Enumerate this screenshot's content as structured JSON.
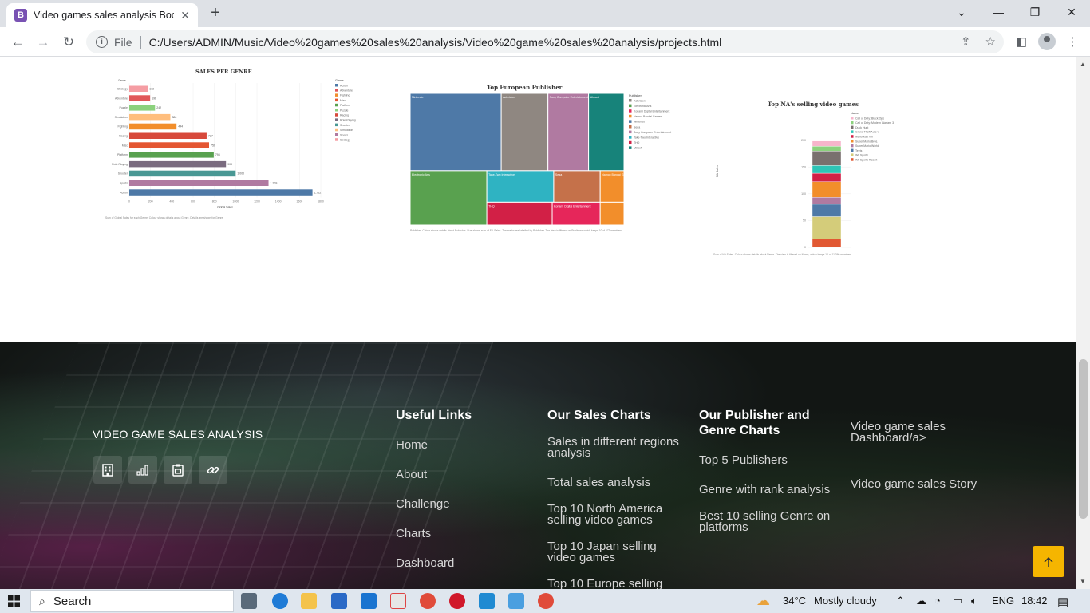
{
  "browser": {
    "tab_title": "Video games sales analysis Bootstrap",
    "tab_favicon": "B",
    "file_label": "File",
    "url": "C:/Users/ADMIN/Music/Video%20games%20sales%20analysis/Video%20game%20sales%20analysis/projects.html"
  },
  "chart_data": [
    {
      "type": "bar",
      "title": "SALES PER GENRE",
      "ylabel": "Genre",
      "xlabel": "Global Sales",
      "categories": [
        "Strategy",
        "Adventure",
        "Puzzle",
        "Simulation",
        "Fighting",
        "Racing",
        "Misc",
        "Platform",
        "Role-Playing",
        "Shooter",
        "Sports",
        "Action"
      ],
      "values": [
        173,
        196,
        242,
        386,
        444,
        727,
        750,
        794,
        909,
        1000,
        1309,
        1722
      ],
      "value_labels": [
        "173",
        "196",
        "242",
        "386",
        "444",
        "727",
        "750",
        "794",
        "909",
        "1,000",
        "1,309",
        "1,722"
      ],
      "xticks": [
        "0",
        "200",
        "400",
        "600",
        "800",
        "1000",
        "1200",
        "1400",
        "1600",
        "1800"
      ],
      "xlim": [
        0,
        1800
      ],
      "colors": [
        "#f59da3",
        "#e15759",
        "#8cd17d",
        "#ffbe7d",
        "#f28e2b",
        "#d7493b",
        "#e45632",
        "#59a14f",
        "#7a6b7f",
        "#499894",
        "#b07aa1",
        "#4e79a7"
      ],
      "legend_title": "Genre",
      "legend": [
        {
          "label": "Action",
          "color": "#4e79a7"
        },
        {
          "label": "Adventure",
          "color": "#e15759"
        },
        {
          "label": "Fighting",
          "color": "#f28e2b"
        },
        {
          "label": "Misc",
          "color": "#e45632"
        },
        {
          "label": "Platform",
          "color": "#59a14f"
        },
        {
          "label": "Puzzle",
          "color": "#8cd17d"
        },
        {
          "label": "Racing",
          "color": "#d7493b"
        },
        {
          "label": "Role-Playing",
          "color": "#7a6b7f"
        },
        {
          "label": "Shooter",
          "color": "#499894"
        },
        {
          "label": "Simulation",
          "color": "#ffbe7d"
        },
        {
          "label": "Sports",
          "color": "#b07aa1"
        },
        {
          "label": "Strategy",
          "color": "#f59da3"
        }
      ],
      "footnote": "Sum of Global Sales for each Genre. Colour shows details about Genre. Details are shown for Genre."
    },
    {
      "type": "treemap",
      "title": "Top European Publisher",
      "tiles": [
        {
          "label": "Nintendo",
          "value": 419,
          "color": "#4e79a7"
        },
        {
          "label": "Electronic Arts",
          "value": 371,
          "color": "#59a14f"
        },
        {
          "label": "Activision",
          "value": 215,
          "color": "#8f8781"
        },
        {
          "label": "Sony Computer Entertainment",
          "value": 187,
          "color": "#b07aa1"
        },
        {
          "label": "Ubisoft",
          "value": 163,
          "color": "#17837a"
        },
        {
          "label": "Take-Two Interactive",
          "value": 118,
          "color": "#2fb3c2"
        },
        {
          "label": "THQ",
          "value": 94,
          "color": "#d22046"
        },
        {
          "label": "Sega",
          "value": 82,
          "color": "#c5714a"
        },
        {
          "label": "Namco Bandai Games",
          "value": 42,
          "color": "#f28e2b"
        },
        {
          "label": "Konami Digital Entertainment",
          "value": 69,
          "color": "#e6265a"
        }
      ],
      "legend_title": "Publisher",
      "legend": [
        {
          "label": "Activision",
          "color": "#8f8781"
        },
        {
          "label": "Electronic Arts",
          "color": "#59a14f"
        },
        {
          "label": "Konami Digital Entertainment",
          "color": "#e6265a"
        },
        {
          "label": "Namco Bandai Games",
          "color": "#f28e2b"
        },
        {
          "label": "Nintendo",
          "color": "#4e79a7"
        },
        {
          "label": "Sega",
          "color": "#c5714a"
        },
        {
          "label": "Sony Computer Entertainment",
          "color": "#b07aa1"
        },
        {
          "label": "Take-Two Interactive",
          "color": "#2fb3c2"
        },
        {
          "label": "THQ",
          "color": "#d22046"
        },
        {
          "label": "Ubisoft",
          "color": "#17837a"
        }
      ],
      "footnote": "Publisher. Colour shows details about Publisher. Size shows sum of EU Sales. The marks are labelled by Publisher. The view is filtered on Publisher, which keeps 10 of 577 members."
    },
    {
      "type": "bar",
      "stacked": true,
      "title": "Top NA's selling video games",
      "ylabel": "NA Sales",
      "yticks": [
        "0",
        "50",
        "100",
        "150",
        "200"
      ],
      "ylim": [
        0,
        250
      ],
      "series": [
        {
          "name": "Call of Duty: Black Ops",
          "value": 9.7,
          "color": "#f7b5cb"
        },
        {
          "name": "Call of Duty: Modern Warfare 3",
          "value": 9.0,
          "color": "#8cd17d"
        },
        {
          "name": "Duck Hunt",
          "value": 26.9,
          "color": "#79706e"
        },
        {
          "name": "Grand Theft Auto V",
          "value": 14.4,
          "color": "#2ec4b6"
        },
        {
          "name": "Mario Kart Wii",
          "value": 15.9,
          "color": "#d22046"
        },
        {
          "name": "Super Mario Bros.",
          "value": 29.1,
          "color": "#f28e2b"
        },
        {
          "name": "Super Mario World",
          "value": 12.8,
          "color": "#b07aa1"
        },
        {
          "name": "Tetris",
          "value": 23.2,
          "color": "#4e79a7"
        },
        {
          "name": "Wii Sports",
          "value": 41.5,
          "color": "#d4cc7a"
        },
        {
          "name": "Wii Sports Resort",
          "value": 15.8,
          "color": "#e15832"
        }
      ],
      "legend_title": "Name",
      "footnote": "Sum of NA Sales. Colour shows details about Name. The view is filtered on Name, which keeps 10 of 11,360 members."
    }
  ],
  "footer": {
    "brand": "VIDEO GAME SALES ANALYSIS",
    "social_icons": [
      "building-icon",
      "bar-chart-icon",
      "clipboard-icon",
      "link-icon"
    ],
    "useful_links": {
      "heading": "Useful Links",
      "items": [
        "Home",
        "About",
        "Challenge",
        "Charts",
        "Dashboard"
      ]
    },
    "sales_charts": {
      "heading": "Our Sales Charts",
      "items": [
        "Sales in different regions analysis",
        "Total sales analysis",
        "Top 10 North America selling video games",
        "Top 10 Japan selling video games",
        "Top 10 Europe selling"
      ]
    },
    "publisher_charts": {
      "heading": "Our Publisher and Genre Charts",
      "items": [
        "Top 5 Publishers",
        "Genre with rank analysis",
        "Best 10 selling Genre on platforms"
      ]
    },
    "dashboard_links": {
      "items": [
        "Video game sales Dashboard/a>",
        "Video game sales Story"
      ]
    },
    "back_to_top_icon": "arrow-up-icon",
    "accent": "#f5b500"
  },
  "taskbar": {
    "search_placeholder": "Search",
    "temperature": "34°C",
    "weather": "Mostly cloudy",
    "language": "ENG",
    "time": "18:42"
  }
}
